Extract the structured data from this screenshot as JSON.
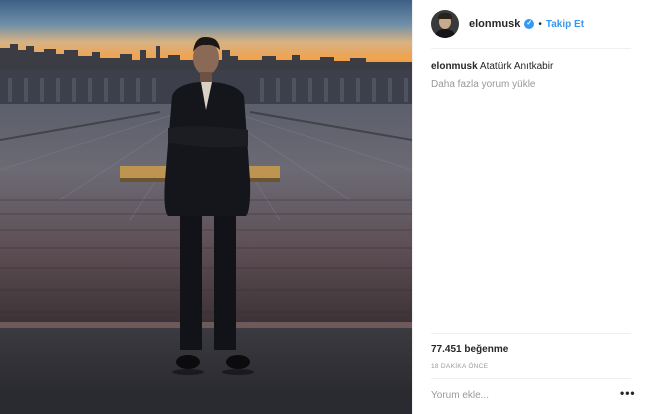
{
  "post": {
    "image_alt": "elonmusk photo at Anıtkabir",
    "header": {
      "username": "elonmusk",
      "verified_icon": "verified-badge-icon",
      "separator": "•",
      "follow_label": "Takip Et"
    },
    "caption": {
      "username": "elonmusk",
      "text": "Atatürk Anıtkabir"
    },
    "load_more_comments": "Daha fazla yorum yükle",
    "likes": "77.451 beğenme",
    "timestamp": "18 DAKİKA ÖNCE",
    "comment_placeholder": "Yorum ekle...",
    "more_options": "•••"
  },
  "colors": {
    "accent": "#3897f0",
    "text": "#262626",
    "muted": "#999999",
    "divider": "#efefef"
  }
}
